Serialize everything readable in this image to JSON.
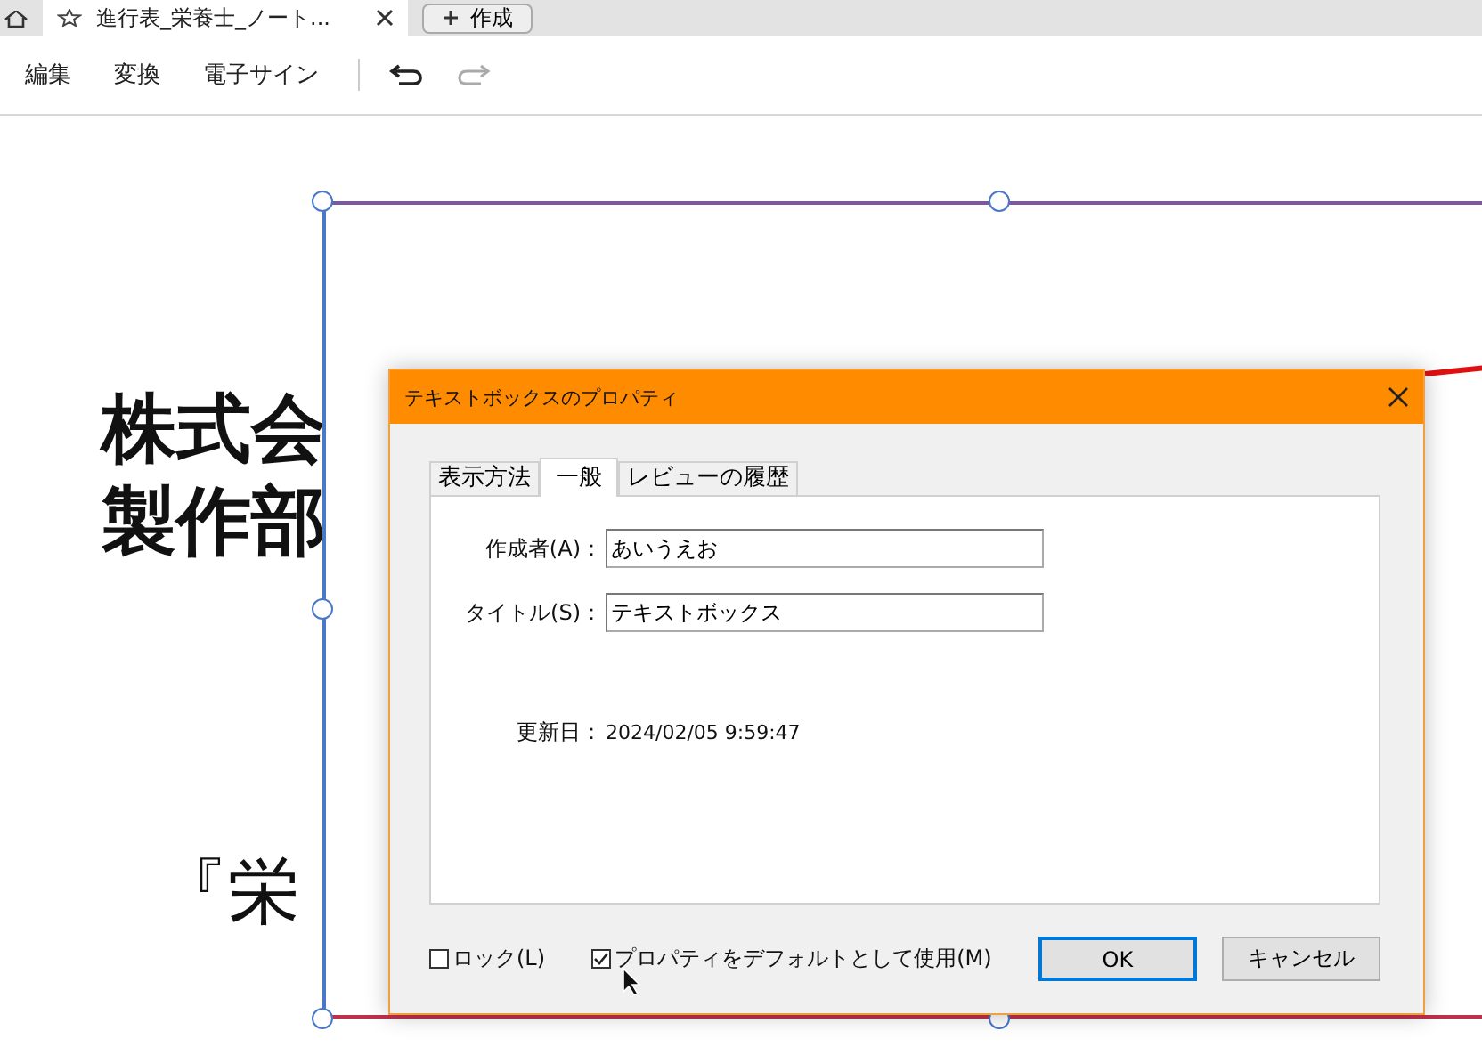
{
  "browser": {
    "tabs": [
      {
        "label": "進行表_栄養士_ノート...",
        "selected": true
      }
    ],
    "new_tab": {
      "label": "作成"
    }
  },
  "toolbar": {
    "menus": [
      "編集",
      "変換",
      "電子サイン"
    ],
    "undo": {
      "disabled": false
    },
    "redo": {
      "disabled": true
    }
  },
  "document": {
    "lines": [
      {
        "text": "株式会",
        "kind": "heading"
      },
      {
        "text": "製作部",
        "kind": "heading"
      },
      {
        "text": "『栄",
        "kind": "body"
      }
    ]
  },
  "dialog": {
    "title": "テキストボックスのプロパティ",
    "tabs": [
      {
        "label": "表示方法",
        "selected": false
      },
      {
        "label": "一般",
        "selected": true
      },
      {
        "label": "レビューの履歴",
        "selected": false
      }
    ],
    "fields": [
      {
        "label": "作成者(A)：",
        "value": "あいうえお"
      },
      {
        "label": "タイトル(S)：",
        "value": "テキストボックス"
      }
    ],
    "modified": {
      "label": "更新日：",
      "value": "2024/02/05 9:59:47"
    },
    "options": [
      {
        "label": "ロック(L)",
        "checked": false
      },
      {
        "label": "プロパティをデフォルトとして使用(M)",
        "checked": true
      }
    ],
    "buttons": [
      {
        "label": "OK",
        "default": true
      },
      {
        "label": "キャンセル",
        "default": false
      }
    ]
  }
}
